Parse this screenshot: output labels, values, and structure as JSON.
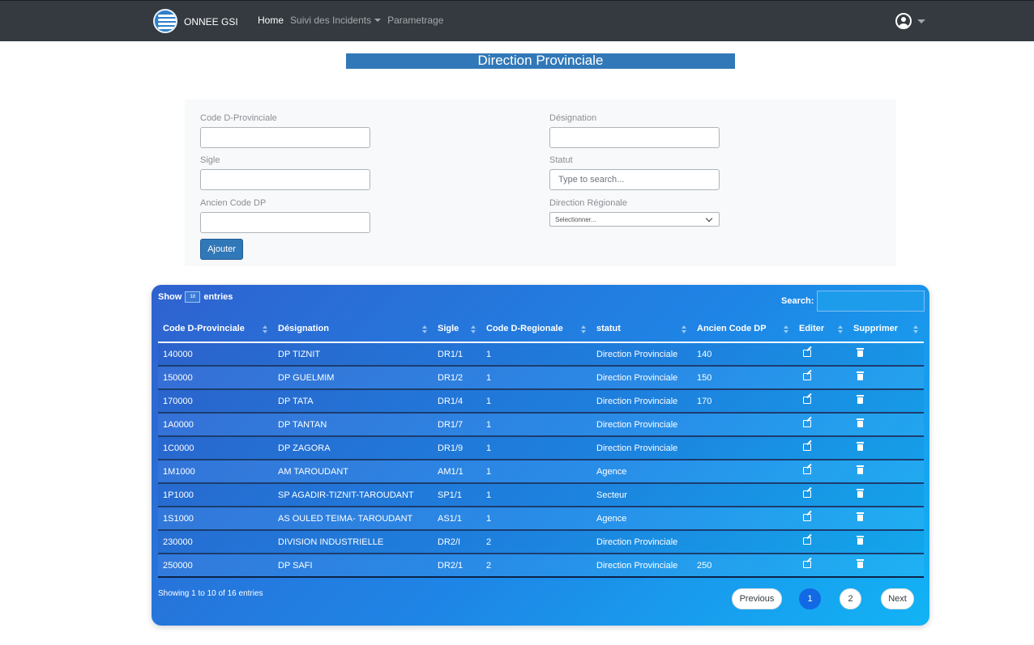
{
  "navbar": {
    "brand": "ONNEE GSI",
    "links": [
      {
        "label": "Home",
        "active": true,
        "dropdown": false
      },
      {
        "label": "Suivi des Incidents",
        "active": false,
        "dropdown": true
      },
      {
        "label": "Parametrage",
        "active": false,
        "dropdown": false
      }
    ]
  },
  "title": "Direction Provinciale",
  "form": {
    "code_label": "Code D-Provinciale",
    "code_value": "",
    "sigle_label": "Sigle",
    "sigle_value": "",
    "ancien_label": "Ancien Code DP",
    "ancien_value": "",
    "designation_label": "Désignation",
    "designation_value": "",
    "statut_label": "Statut",
    "statut_placeholder": "Type to search...",
    "region_label": "Direction Régionale",
    "region_selected": "Selectionner...",
    "add_button": "Ajouter"
  },
  "table": {
    "show_label": "Show",
    "entries_label": "entries",
    "length_value": "10",
    "search_label": "Search:",
    "columns": [
      "Code D-Provinciale",
      "Désignation",
      "Sigle",
      "Code D-Regionale",
      "statut",
      "Ancien Code DP",
      "Editer",
      "Supprimer"
    ],
    "rows": [
      [
        "140000",
        "DP TIZNIT",
        "DR1/1",
        "1",
        "Direction Provinciale",
        "140"
      ],
      [
        "150000",
        "DP GUELMIM",
        "DR1/2",
        "1",
        "Direction Provinciale",
        "150"
      ],
      [
        "170000",
        "DP TATA",
        "DR1/4",
        "1",
        "Direction Provinciale",
        "170"
      ],
      [
        "1A0000",
        "DP TANTAN",
        "DR1/7",
        "1",
        "Direction Provinciale",
        ""
      ],
      [
        "1C0000",
        "DP ZAGORA",
        "DR1/9",
        "1",
        "Direction Provinciale",
        ""
      ],
      [
        "1M1000",
        "AM TAROUDANT",
        "AM1/1",
        "1",
        "Agence",
        ""
      ],
      [
        "1P1000",
        "SP AGADIR-TIZNIT-TAROUDANT",
        "SP1/1",
        "1",
        "Secteur",
        ""
      ],
      [
        "1S1000",
        "AS OULED TEIMA- TAROUDANT",
        "AS1/1",
        "1",
        "Agence",
        ""
      ],
      [
        "230000",
        "DIVISION INDUSTRIELLE",
        "DR2/I",
        "2",
        "Direction Provinciale",
        ""
      ],
      [
        "250000",
        "DP SAFI",
        "DR2/1",
        "2",
        "Direction Provinciale",
        "250"
      ]
    ],
    "info": "Showing 1 to 10 of 16 entries",
    "pagination": {
      "previous": "Previous",
      "pages": [
        "1",
        "2"
      ],
      "current": "1",
      "next": "Next"
    }
  },
  "icons": {
    "edit": "edit-icon",
    "delete": "trash-icon",
    "user": "user-circle-icon"
  },
  "colors": {
    "navbar": "#343a40",
    "accent": "#3178b8",
    "card_start": "#2f62cf",
    "card_end": "#12b3f5",
    "page_active": "#1269e3"
  }
}
